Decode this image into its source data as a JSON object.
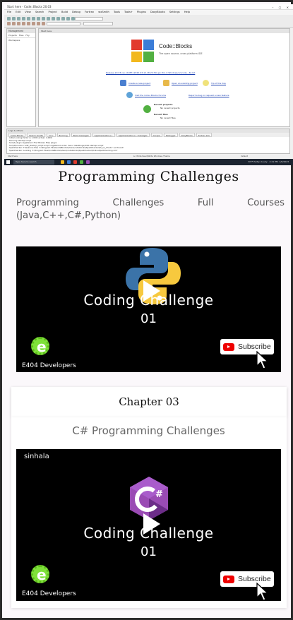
{
  "screenshot": {
    "window_title": "Start here - Code::Blocks 20.03",
    "menu": [
      "File",
      "Edit",
      "View",
      "Search",
      "Project",
      "Build",
      "Debug",
      "Fortran",
      "wxSmith",
      "Tools",
      "Tools+",
      "Plugins",
      "DoxyBlocks",
      "Settings",
      "Help"
    ],
    "management": {
      "title": "Management",
      "tabs": [
        "Projects",
        "Files",
        "FSy"
      ],
      "workspace": "Workspace"
    },
    "editor_tab": "Start here",
    "app_name": "Code::Blocks",
    "app_tagline": "The open source, cross-platform IDE",
    "release_link": "Release 20.03 rev 11983 (2020-03-12 18:24:30) gcc 8.1.0 Windows/unicode - 64 bit",
    "links": {
      "create": "Create a new project",
      "open": "Open an existing project",
      "tip": "Tip of the Day",
      "forums": "Visit the Code::Blocks forums",
      "report": "Report a bug or request a new feature"
    },
    "recent_projects": {
      "title": "Recent projects",
      "empty": "No recent projects"
    },
    "recent_files": {
      "title": "Recent files",
      "empty": "No recent files"
    },
    "log": {
      "title": "Logs & others",
      "tabs": [
        "Code::Blocks",
        "Search results",
        "Cccc",
        "Build log",
        "Build messages",
        "CppCheck/Vera++",
        "CppCheck/Vera++ messages",
        "Cscope",
        "Debugger",
        "DoxyBlocks",
        "Fortran info"
      ],
      "lines": [
        "Initial scaling factor is 1.000 (actual: 1.000)",
        "Running startup script",
        "Script plugin registered: Find Broken Files plugin",
        "Script/function 'edit_startup_script.script' registered under menu '&Settings/-Edit startup script'",
        "SpellChecker: Thesaurus files 'C:\\Program Files\\CodeBlocks\\share\\codeblocks\\SpellChecker\\th_en_US.idx' not found!",
        "SpellChecker: Loading 'C:\\Program Files\\CodeBlocks\\share\\codeblocks\\SpellChecker\\OnlineSpellChecking.xml'"
      ]
    },
    "status_bar": "Start here",
    "status_bar_right": "default",
    "status_bar_mid": "Ln Write   Read/Write   Windows Theme",
    "taskbar": {
      "search_placeholder": "Type here to search",
      "weather": "30°F  Partly cloudy",
      "time": "2:21 PM",
      "date": "1/6/2023"
    }
  },
  "page": {
    "title": "Programming Challenges",
    "intro": "Programming Challenges Full Courses (Java,C++,C#,Python)",
    "video1": {
      "line1": "Coding Challenge",
      "line2": "01",
      "subscribe": "Subscribe",
      "brand": "E404 Developers"
    },
    "chapter": "Chapter 03",
    "subtitle": "C# Programming Challenges",
    "video2": {
      "corner_label": "sinhala",
      "line1": "Coding Challenge",
      "line2": "01",
      "subscribe": "Subscribe",
      "brand": "E404 Developers"
    }
  },
  "colors": {
    "page_bg": "#fbf8fb",
    "python_blue": "#3b73a8",
    "python_yellow": "#f7c93e",
    "csharp_purple": "#9a4bb4",
    "youtube_red": "#e00000",
    "e404_green": "#7fe13a"
  },
  "icons": [
    "python-logo-icon",
    "csharp-logo-icon",
    "play-icon",
    "youtube-icon",
    "cursor-icon",
    "e404-logo-icon",
    "codeblocks-logo-icon"
  ]
}
